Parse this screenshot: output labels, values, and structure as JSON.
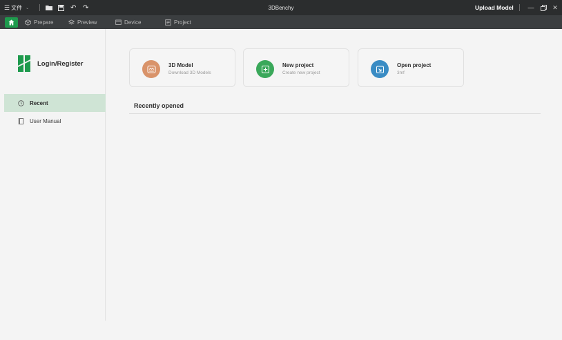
{
  "titlebar": {
    "menu_label": "文件",
    "title": "3DBenchy",
    "upload_label": "Upload Model"
  },
  "tabs": [
    {
      "label": "Prepare",
      "icon": "cube-outline-icon"
    },
    {
      "label": "Preview",
      "icon": "layers-icon"
    },
    {
      "label": "Device",
      "icon": "monitor-icon"
    },
    {
      "label": "Project",
      "icon": "document-icon"
    }
  ],
  "sidebar": {
    "login_label": "Login/Register",
    "items": [
      {
        "label": "Recent",
        "icon": "clock-icon",
        "active": true
      },
      {
        "label": "User Manual",
        "icon": "book-icon",
        "active": false
      }
    ]
  },
  "cards": [
    {
      "title": "3D Model",
      "subtitle": "Download 3D Models",
      "color": "#d9936a"
    },
    {
      "title": "New project",
      "subtitle": "Create new project",
      "color": "#3aa85a"
    },
    {
      "title": "Open project",
      "subtitle": "3mf",
      "color": "#3a8cc4"
    }
  ],
  "recent": {
    "heading": "Recently opened"
  },
  "colors": {
    "accent": "#1e9a4d",
    "titlebar_bg": "#2b2d2e",
    "tabbar_bg": "#3b3e40",
    "active_item_bg": "#cfe4d5"
  }
}
